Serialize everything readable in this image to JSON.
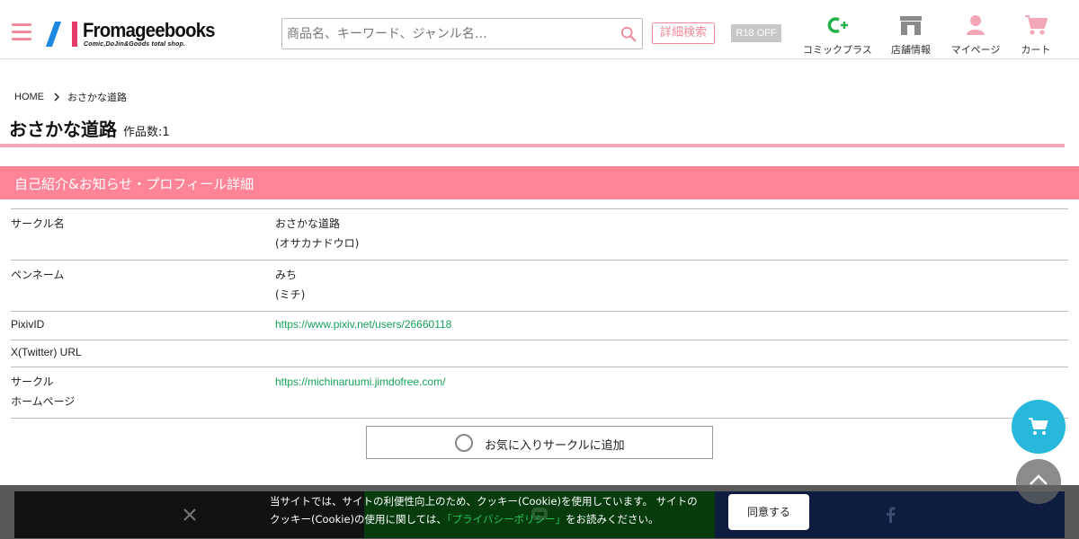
{
  "header": {
    "logo_text": "Fromageebooks",
    "logo_tagline": "Comic,DoJin&Goods total shop.",
    "search_placeholder": "商品名、キーワード、ジャンル名…",
    "advanced_search_label": "詳細検索",
    "r18_label": "R18 OFF",
    "nav": [
      {
        "label": "コミックプラス",
        "icon": "comic-plus-icon"
      },
      {
        "label": "店舗情報",
        "icon": "store-icon"
      },
      {
        "label": "マイページ",
        "icon": "user-icon"
      },
      {
        "label": "カート",
        "icon": "cart-icon"
      }
    ]
  },
  "breadcrumb": {
    "home": "HOME",
    "current": "おさかな道路"
  },
  "page": {
    "title": "おさかな道路",
    "work_count": "作品数:1",
    "section_title": "自己紹介&お知らせ・プロフィール詳細"
  },
  "profile": {
    "circle_name_label": "サークル名",
    "circle_name": "おさかな道路",
    "circle_name_kana": "(オサカナドウロ)",
    "pen_name_label": "ペンネーム",
    "pen_name": "みち",
    "pen_name_kana": "(ミチ)",
    "pixiv_label": "PixivID",
    "pixiv_url": "https://www.pixiv.net/users/26660118",
    "twitter_label": "X(Twitter) URL",
    "twitter_url": "",
    "homepage_label_1": "サークル",
    "homepage_label_2": "ホームページ",
    "homepage_url": "https://michinaruumi.jimdofree.com/"
  },
  "favorite_button": "お気に入りサークルに追加",
  "cookie": {
    "text_before": "当サイトでは、サイトの利便性向上のため、クッキー(Cookie)を使用しています。 サイトのクッキー(Cookie)の使用に関しては、",
    "privacy_link": "「プライバシーポリシー」",
    "text_after": "をお読みください。",
    "agree_label": "同意する"
  },
  "share": [
    "x-icon",
    "line-icon",
    "facebook-icon"
  ],
  "colors": {
    "accent_pink": "#ff8498",
    "link_green": "#14a05a",
    "fab_blue": "#27b8dc"
  }
}
